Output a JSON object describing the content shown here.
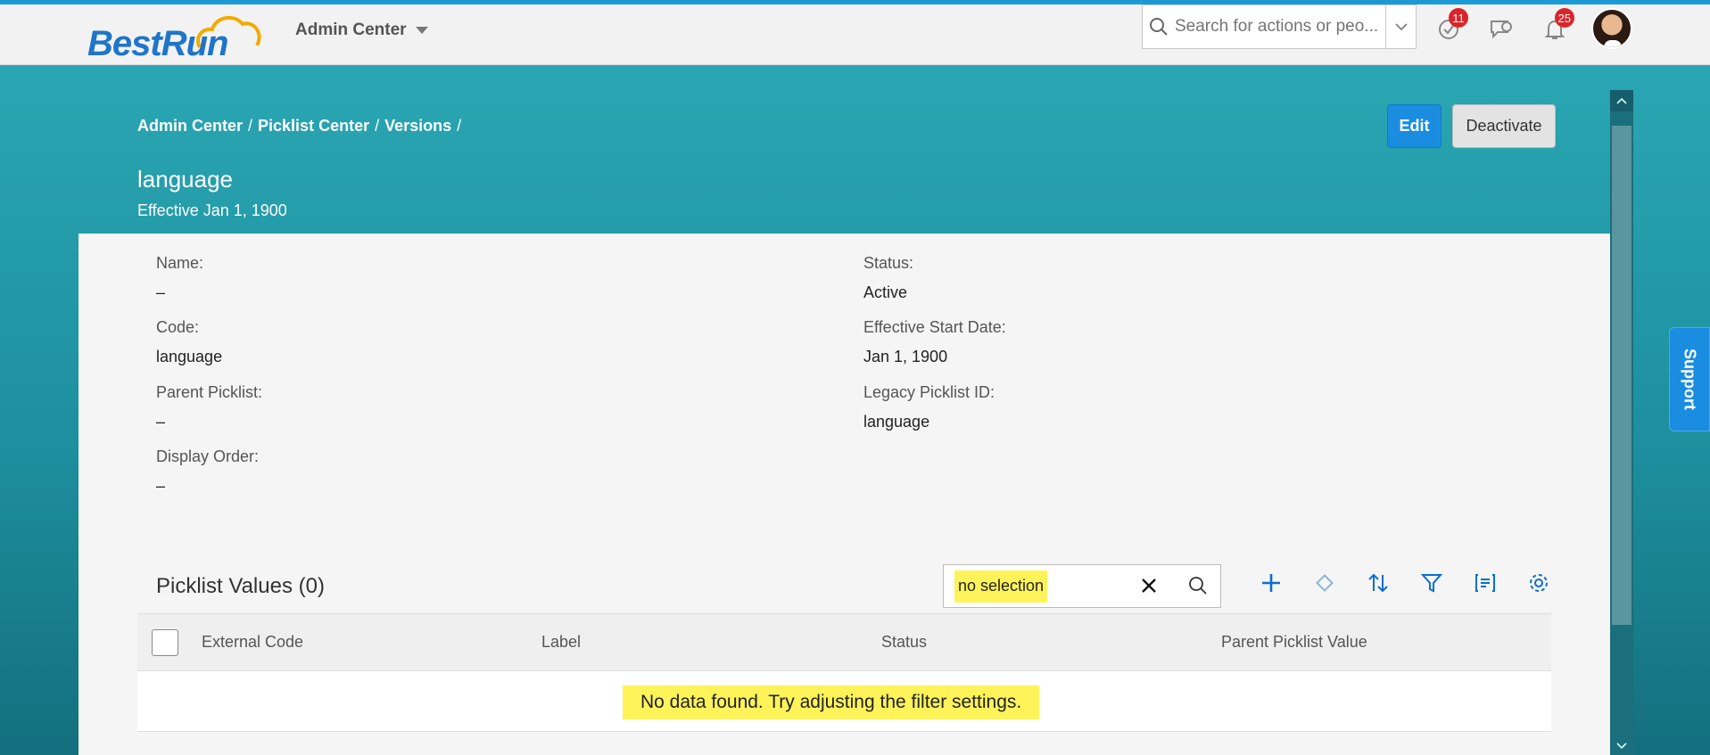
{
  "shell": {
    "logo_best": "Best",
    "logo_run": "Run",
    "module": "Admin Center",
    "search_placeholder": "Search for actions or peo...",
    "todo_badge": "11",
    "notifications_badge": "25"
  },
  "header": {
    "breadcrumb": [
      "Admin Center",
      "Picklist Center",
      "Versions"
    ],
    "title": "language",
    "subtitle": "Effective Jan 1, 1900",
    "edit_label": "Edit",
    "deactivate_label": "Deactivate"
  },
  "details": {
    "name_label": "Name:",
    "name_value": "–",
    "code_label": "Code:",
    "code_value": "language",
    "parent_label": "Parent Picklist:",
    "parent_value": "–",
    "order_label": "Display Order:",
    "order_value": "–",
    "status_label": "Status:",
    "status_value": "Active",
    "start_label": "Effective Start Date:",
    "start_value": "Jan 1, 1900",
    "legacy_label": "Legacy Picklist ID:",
    "legacy_value": "language"
  },
  "values_section": {
    "title": "Picklist Values (0)",
    "filter_value": "no selection",
    "columns": [
      "External Code",
      "Label",
      "Status",
      "Parent Picklist Value"
    ],
    "empty_message": "No data found. Try adjusting the filter settings."
  },
  "support_label": "Support",
  "colors": {
    "teal": "#2aa6b3",
    "accent": "#1a8de0",
    "highlight": "#fff35a",
    "badge": "#d9252a"
  }
}
